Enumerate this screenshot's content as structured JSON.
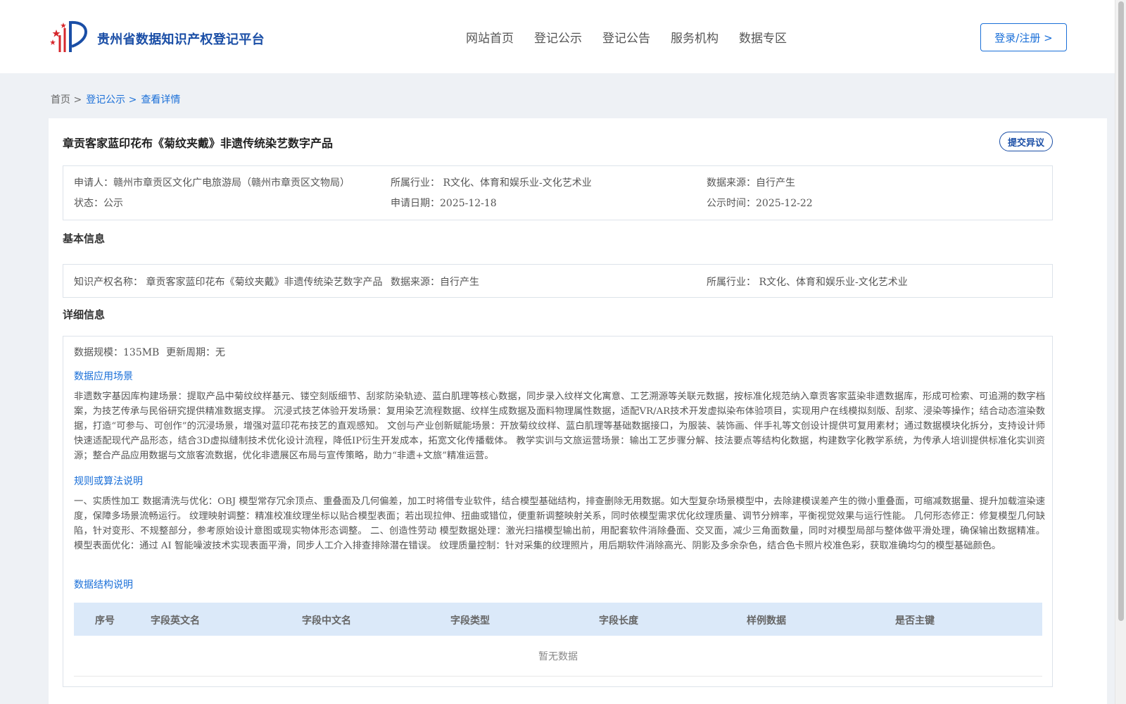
{
  "header": {
    "site_name": "贵州省数据知识产权登记平台",
    "nav": [
      "网站首页",
      "登记公示",
      "登记公告",
      "服务机构",
      "数据专区"
    ],
    "login_label": "登录/注册 >"
  },
  "breadcrumb": {
    "home": "首页 >",
    "public": "登记公示 >",
    "current": "查看详情"
  },
  "detail": {
    "title": "章贡客家蓝印花布《菊纹夹戴》非遗传统染艺数字产品",
    "objection_label": "提交异议",
    "summary": {
      "applicant": "申请人：赣州市章贡区文化广电旅游局（赣州市章贡区文物局）",
      "industry": "所属行业： R文化、体育和娱乐业-文化艺术业",
      "source": "数据来源：自行产生",
      "status": "状态：公示",
      "apply_date": "申请日期：2025-12-18",
      "publish_time": "公示时间：2025-12-22"
    },
    "basic_title": "基本信息",
    "basic": {
      "ip_name": "知识产权名称： 章贡客家蓝印花布《菊纹夹戴》非遗传统染艺数字产品",
      "source": "数据来源：自行产生",
      "industry": "所属行业： R文化、体育和娱乐业-文化艺术业"
    },
    "detail_title": "详细信息",
    "scale": "数据规模：135MB",
    "cycle": "更新周期：无",
    "scene_title": "数据应用场景",
    "scene_text": "非遗数字基因库构建场景：提取产品中菊纹纹样基元、镂空刻版细节、刮浆防染轨迹、蓝白肌理等核心数据，同步录入纹样文化寓意、工艺溯源等关联元数据，按标准化规范纳入章贡客家蓝染非遗数据库，形成可检索、可追溯的数字档案，为技艺传承与民俗研究提供精准数据支撑。 沉浸式技艺体验开发场景：复用染艺流程数据、纹样生成数据及面料物理属性数据，适配VR/AR技术开发虚拟染布体验项目，实现用户在线模拟刻版、刮浆、浸染等操作；结合动态渲染数据，打造“可参与、可创作”的沉浸场景，增强对蓝印花布技艺的直观感知。 文创与产业创新赋能场景：开放菊纹纹样、蓝白肌理等基础数据接口，为服装、装饰画、伴手礼等文创设计提供可复用素材；通过数据模块化拆分，支持设计师快速适配现代产品形态，结合3D虚拟缝制技术优化设计流程，降低IP衍生开发成本，拓宽文化传播载体。 教学实训与文旅运营场景：输出工艺步骤分解、技法要点等结构化数据，构建数字化教学系统，为传承人培训提供标准化实训资源；整合产品应用数据与文旅客流数据，优化非遗展区布局与宣传策略，助力“非遗+文旅”精准运营。",
    "rule_title": "规则或算法说明",
    "rule_text": "一、实质性加工 数据清洗与优化：OBJ 模型常存冗余顶点、重叠面及几何偏差，加工时将借专业软件，结合模型基础结构，排查删除无用数据。如大型复杂场景模型中，去除建模误差产生的微小重叠面，可缩减数据量、提升加载渲染速度，保障多场景流畅运行。 纹理映射调整：精准校准纹理坐标以贴合模型表面；若出现拉伸、扭曲或错位，便重新调整映射关系，同时依模型需求优化纹理质量、调节分辨率，平衡视觉效果与运行性能。 几何形态修正：修复模型几何缺陷，针对变形、不规整部分，参考原始设计意图或现实物体形态调整。 二、创造性劳动 模型数据处理：激光扫描模型输出前，用配套软件消除叠面、交叉面，减少三角面数量，同时对模型局部与整体做平滑处理，确保输出数据精准。 模型表面优化：通过 AI 智能噪波技术实现表面平滑，同步人工介入排查排除潜在错误。 纹理质量控制：针对采集的纹理照片，用后期软件消除高光、阴影及多余杂色，结合色卡照片校准色彩，获取准确均匀的模型基础颜色。",
    "struct_title": "数据结构说明",
    "table_headers": [
      "序号",
      "字段英文名",
      "字段中文名",
      "字段类型",
      "字段长度",
      "样例数据",
      "是否主键"
    ],
    "empty_text": "暂无数据"
  },
  "colors": {
    "brand": "#1a4ea6",
    "link": "#1a6fd8",
    "table_header_bg": "#dbe9f9",
    "page_bg": "#eef1f5"
  }
}
